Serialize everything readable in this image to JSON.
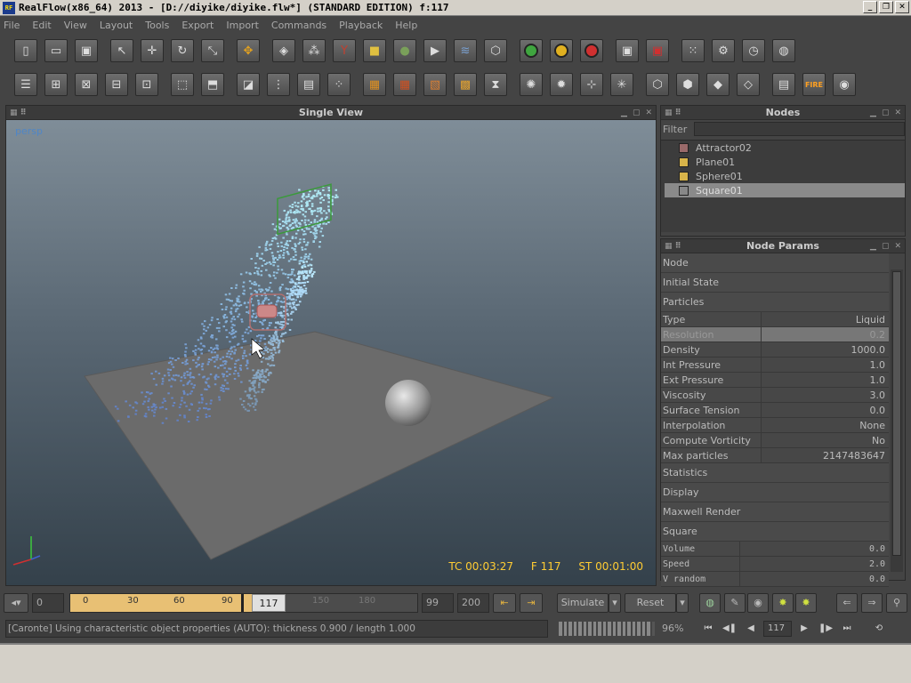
{
  "window": {
    "icon_label": "RF",
    "title": "RealFlow(x86_64) 2013 - [D://diyike/diyike.flw*] (STANDARD EDITION) f:117",
    "min": "_",
    "restore": "❐",
    "close": "✕"
  },
  "menu": [
    "File",
    "Edit",
    "View",
    "Layout",
    "Tools",
    "Export",
    "Import",
    "Commands",
    "Playback",
    "Help"
  ],
  "viewport": {
    "title": "Single View",
    "camera": "persp",
    "tc": "TC 00:03:27",
    "frame": "F 117",
    "st": "ST 00:01:00"
  },
  "nodes": {
    "title": "Nodes",
    "filter_label": "Filter",
    "items": [
      {
        "label": "Attractor02",
        "icon": "attractor-icon",
        "color": "#9a6a6a"
      },
      {
        "label": "Plane01",
        "icon": "object-icon",
        "color": "#d8b44a"
      },
      {
        "label": "Sphere01",
        "icon": "object-icon",
        "color": "#d8b44a"
      },
      {
        "label": "Square01",
        "icon": "emitter-icon",
        "color": "#888888"
      }
    ],
    "selected_index": 3
  },
  "params": {
    "title": "Node Params",
    "sections_top": [
      "Node",
      "Initial State",
      "Particles"
    ],
    "rows": [
      {
        "k": "Type",
        "v": "Liquid"
      },
      {
        "k": "Resolution",
        "v": "0.2"
      },
      {
        "k": "Density",
        "v": "1000.0"
      },
      {
        "k": "Int Pressure",
        "v": "1.0"
      },
      {
        "k": "Ext Pressure",
        "v": "1.0"
      },
      {
        "k": "Viscosity",
        "v": "3.0"
      },
      {
        "k": "Surface Tension",
        "v": "0.0"
      },
      {
        "k": "Interpolation",
        "v": "None"
      },
      {
        "k": "Compute Vorticity",
        "v": "No"
      },
      {
        "k": "Max particles",
        "v": "2147483647"
      }
    ],
    "sections_bottom": [
      "Statistics",
      "Display",
      "Maxwell Render",
      "Square"
    ],
    "square_rows": [
      {
        "k": "Volume",
        "v": "0.0"
      },
      {
        "k": "Speed",
        "v": "2.0"
      },
      {
        "k": "V random",
        "v": "0.0"
      }
    ]
  },
  "timeline": {
    "start": "0",
    "ticks": [
      "0",
      "30",
      "60",
      "90",
      "150",
      "180"
    ],
    "current": "117",
    "end_play": "99",
    "end": "200",
    "simulate": "Simulate",
    "reset": "Reset",
    "played_fraction": 0.585
  },
  "status": {
    "message": "[Caronte] Using characteristic object properties (AUTO): thickness 0.900 / length 1.000",
    "percent": "96%",
    "frame": "117",
    "progress": 0.96
  },
  "colors": {
    "accent_hud": "#ffcc33",
    "persp": "#4f86c6",
    "timeline_played": "#e8c074"
  }
}
